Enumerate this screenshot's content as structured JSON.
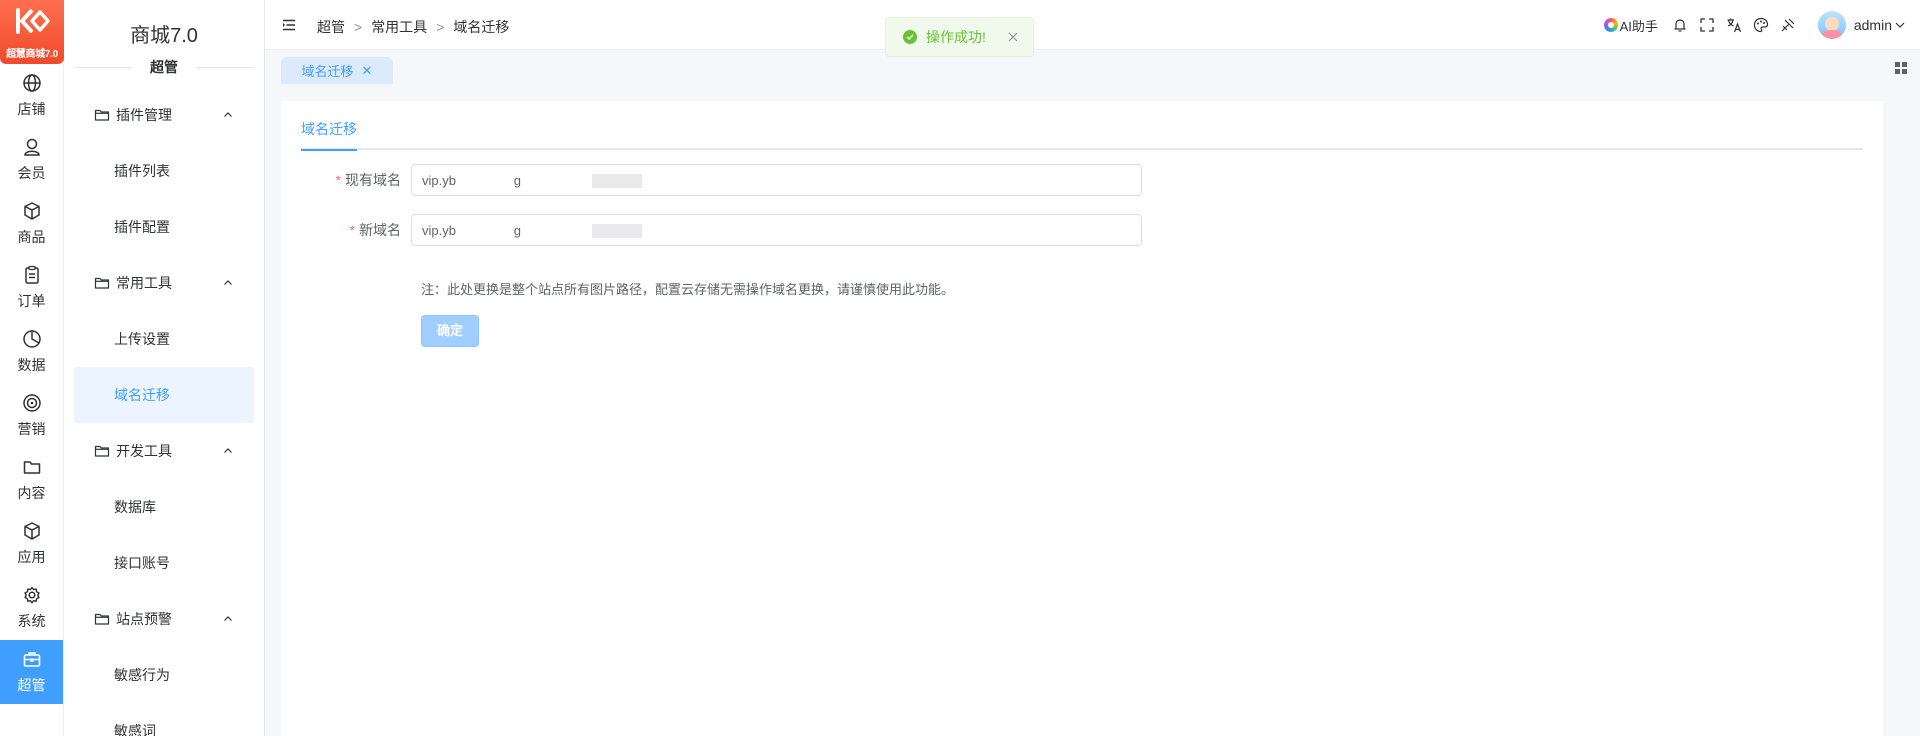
{
  "logo": {
    "badge": "超慧商城7.0"
  },
  "rail": [
    {
      "label": "店铺",
      "icon": "globe-icon"
    },
    {
      "label": "会员",
      "icon": "user-icon"
    },
    {
      "label": "商品",
      "icon": "box-icon"
    },
    {
      "label": "订单",
      "icon": "clipboard-icon"
    },
    {
      "label": "数据",
      "icon": "pie-icon"
    },
    {
      "label": "营销",
      "icon": "target-icon"
    },
    {
      "label": "内容",
      "icon": "folder-icon"
    },
    {
      "label": "应用",
      "icon": "cube-icon"
    },
    {
      "label": "系统",
      "icon": "gear-icon"
    },
    {
      "label": "超管",
      "icon": "toolbox-icon",
      "active": true
    }
  ],
  "submenu": {
    "app_title": "商城7.0",
    "section": "超管",
    "groups": [
      {
        "label": "插件管理",
        "items": [
          "插件列表",
          "插件配置"
        ]
      },
      {
        "label": "常用工具",
        "items": [
          "上传设置",
          "域名迁移"
        ]
      },
      {
        "label": "开发工具",
        "items": [
          "数据库",
          "接口账号"
        ]
      },
      {
        "label": "站点预警",
        "items": [
          "敏感行为",
          "敏感词"
        ]
      }
    ],
    "active_item": "域名迁移"
  },
  "header": {
    "breadcrumb": [
      "超管",
      "常用工具",
      "域名迁移"
    ],
    "ai_label": "AI助手",
    "username": "admin"
  },
  "tabs": [
    {
      "label": "域名迁移"
    }
  ],
  "toast": {
    "text": "操作成功!"
  },
  "main": {
    "page_tab": "域名迁移",
    "fields": {
      "current_label": "现有域名",
      "current_value": "vip.yb                g",
      "new_label": "新域名",
      "new_value": "vip.yb                g"
    },
    "note": "注：此处更换是整个站点所有图片路径，配置云存储无需操作域名更换，请谨慎使用此功能。",
    "submit": "确定"
  },
  "colors": {
    "primary": "#409eff",
    "success": "#67c23a",
    "danger": "#f56c6c",
    "logo": "#f04a2b"
  }
}
